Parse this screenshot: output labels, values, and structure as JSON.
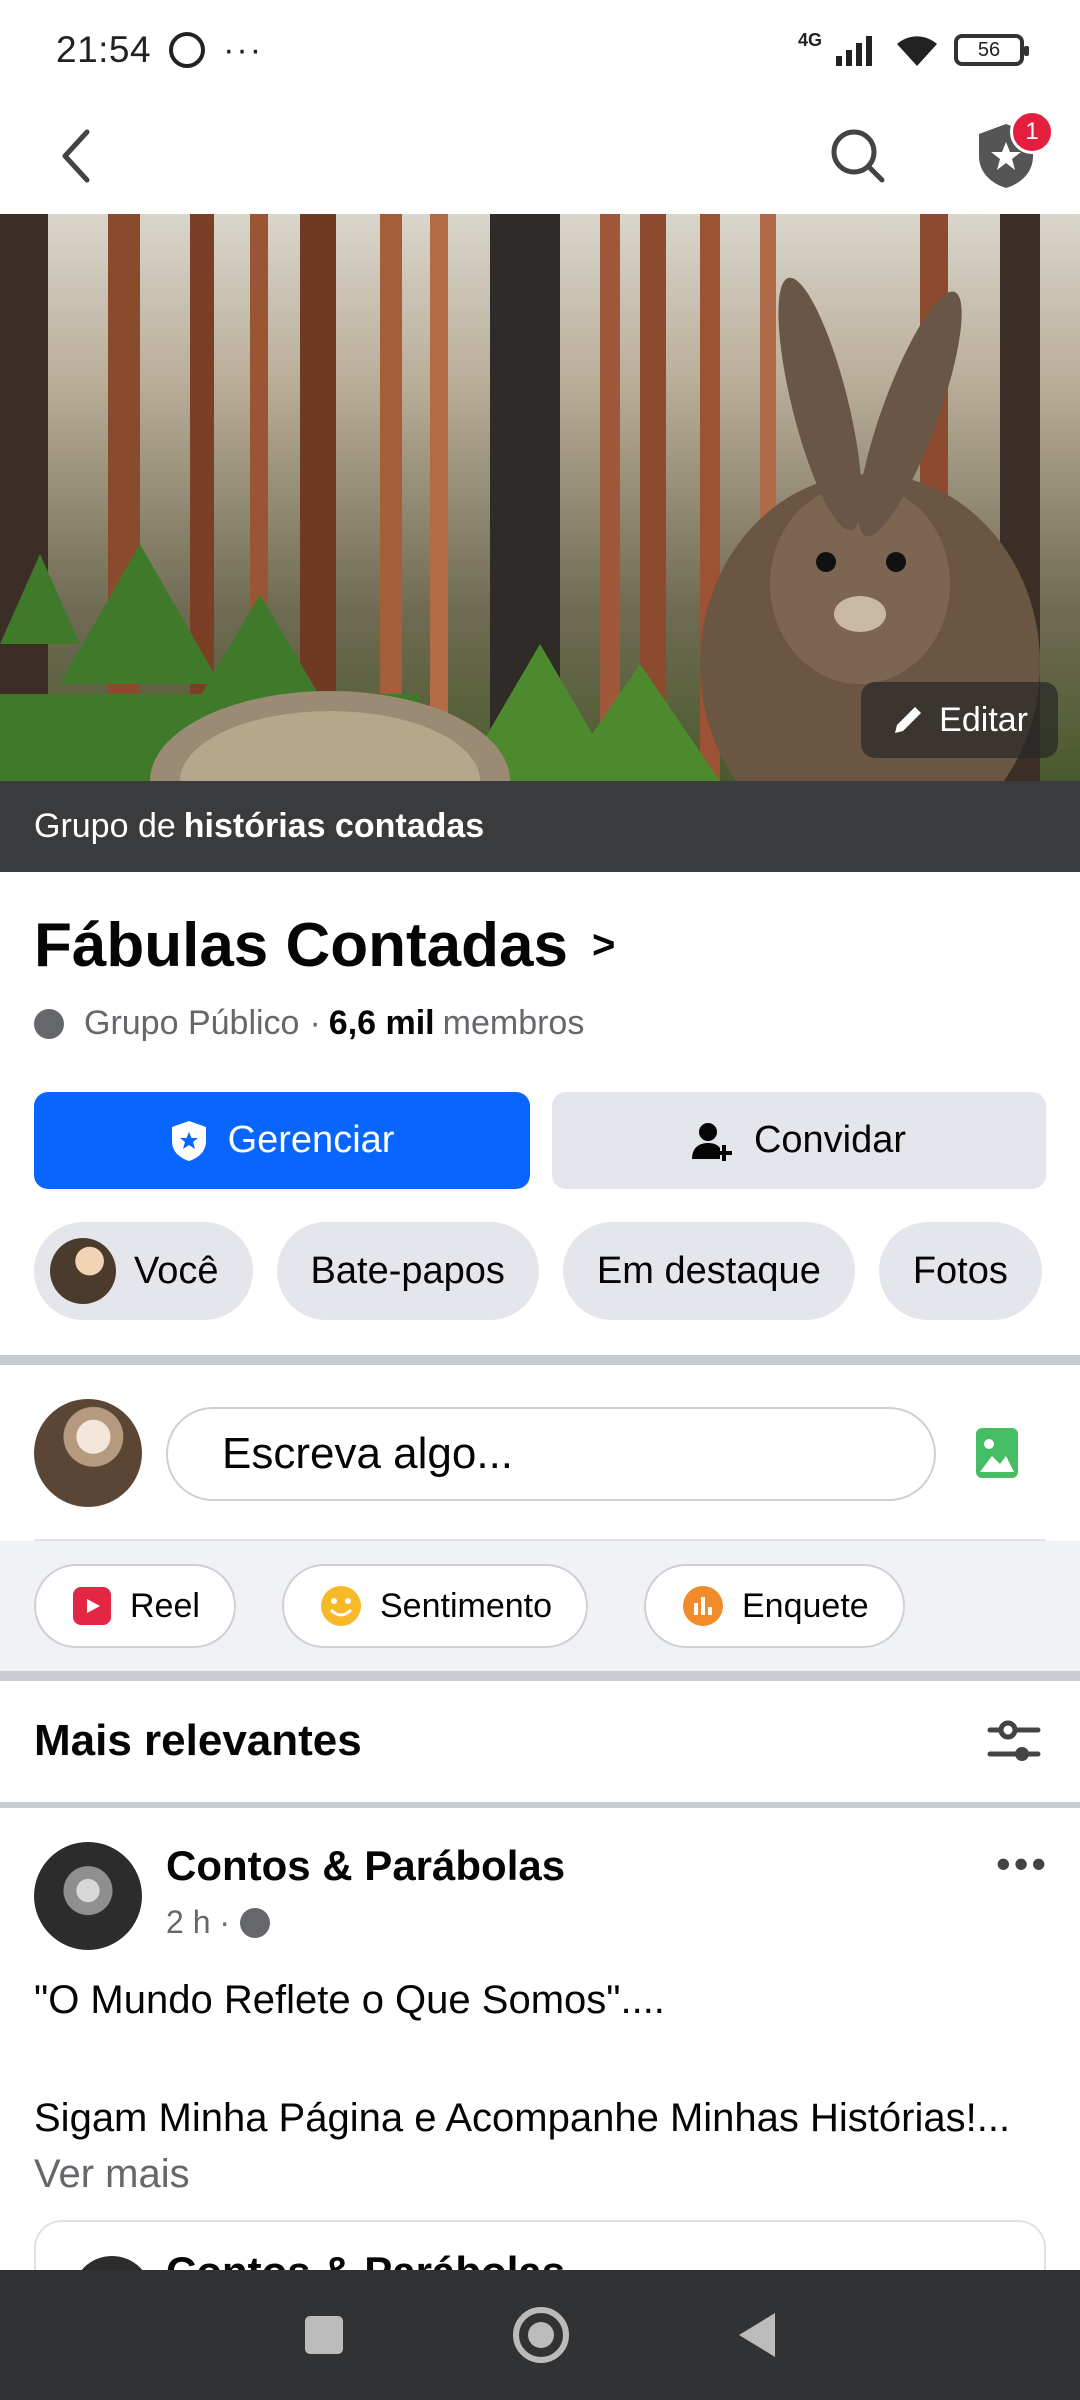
{
  "status_bar": {
    "time": "21:54",
    "more": "···",
    "network": "4G",
    "battery": "56"
  },
  "top_nav": {
    "notification_count": "1"
  },
  "cover": {
    "edit_label": "Editar",
    "banner_prefix": "Grupo de",
    "banner_bold": "histórias contadas"
  },
  "group": {
    "name": "Fábulas Contadas",
    "privacy": "Grupo Público",
    "separator": "·",
    "members_count": "6,6 mil",
    "members_label": "membros"
  },
  "buttons": {
    "manage": "Gerenciar",
    "invite": "Convidar"
  },
  "chips": [
    "Você",
    "Bate-papos",
    "Em destaque",
    "Fotos"
  ],
  "composer": {
    "placeholder": "Escreva algo..."
  },
  "actions": {
    "reel": "Reel",
    "feeling": "Sentimento",
    "poll": "Enquete"
  },
  "feed": {
    "sort_label": "Mais relevantes"
  },
  "post": {
    "author": "Contos & Parábolas",
    "time": "2 h ·",
    "line1": "\"O Mundo Reflete o Que Somos\"....",
    "line2": "Sigam Minha Página e Acompanhe Minhas Histórias!...",
    "see_more": "Ver mais",
    "shared_author": "Contos & Parábolas"
  },
  "colors": {
    "primary": "#0866ff",
    "chip_bg": "#e4e6eb",
    "notification": "#e41e3f"
  }
}
